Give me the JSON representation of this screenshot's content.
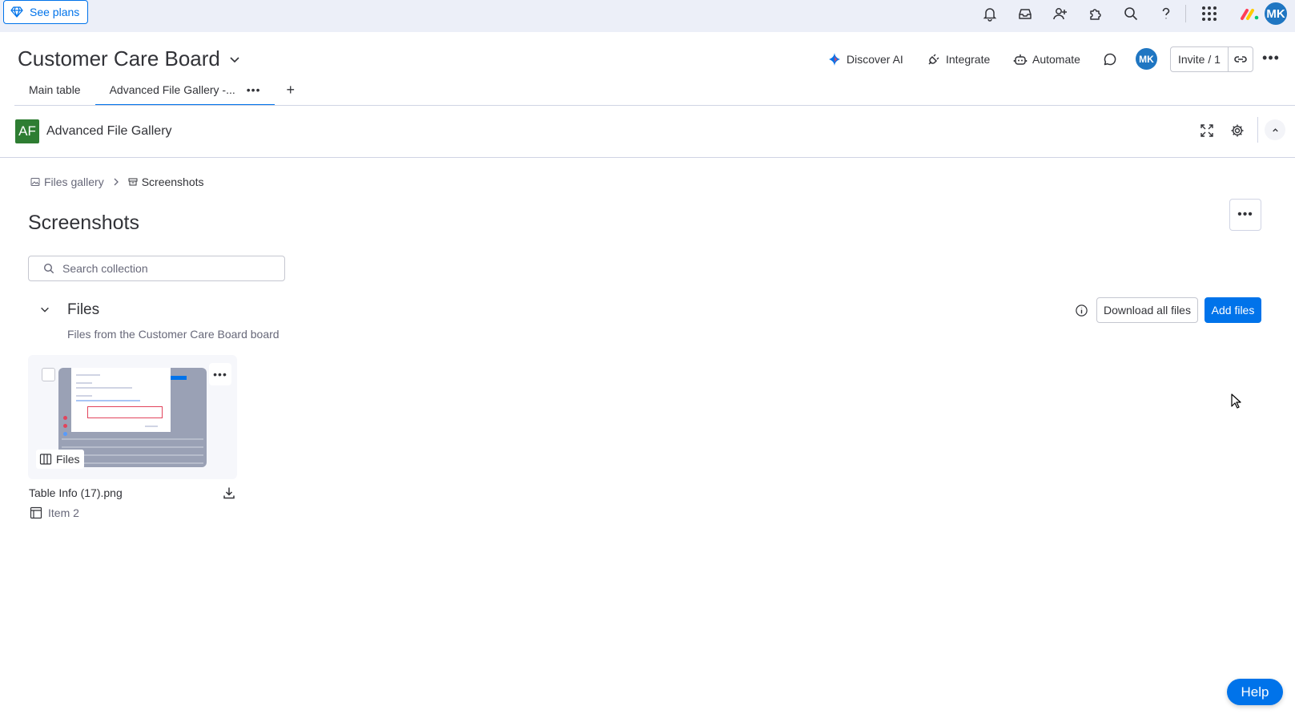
{
  "topbar": {
    "see_plans_label": "See plans",
    "user_initials": "MK"
  },
  "board": {
    "title": "Customer Care Board",
    "actions": {
      "discover_ai": "Discover AI",
      "integrate": "Integrate",
      "automate": "Automate"
    },
    "member_initials": "MK",
    "invite_label": "Invite / 1"
  },
  "tabs": [
    {
      "label": "Main table"
    },
    {
      "label": "Advanced File Gallery -..."
    }
  ],
  "tab_add_label": "+",
  "app": {
    "badge": "AF",
    "name": "Advanced File Gallery"
  },
  "breadcrumb": {
    "root": "Files gallery",
    "current": "Screenshots"
  },
  "page": {
    "title": "Screenshots",
    "search_placeholder": "Search collection"
  },
  "files": {
    "title": "Files",
    "subtitle": "Files from the Customer Care Board board",
    "download_all_label": "Download all files",
    "add_files_label": "Add files",
    "items": [
      {
        "file_name": "Table Info (17).png",
        "tag": "Files",
        "item_name": "Item 2"
      }
    ]
  },
  "help_label": "Help",
  "colors": {
    "accent": "#0073ea",
    "topbar_bg": "#eceff8",
    "app_badge": "#2e7d32",
    "avatar": "#1f76c2"
  }
}
